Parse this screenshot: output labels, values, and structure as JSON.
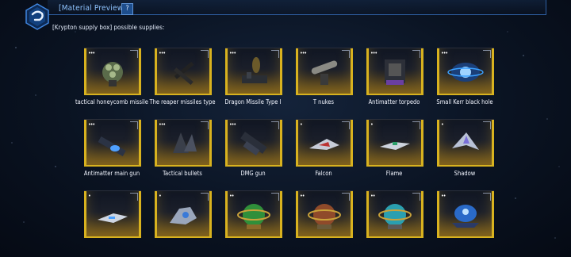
{
  "header": {
    "title": "[Material Preview]",
    "help_label": "?"
  },
  "subtitle": "[Krypton supply box] possible supplies:",
  "colors": {
    "accent_blue": "#3a78c8",
    "frame_gold": "#d8b21f",
    "title_blue": "#8ec3ff"
  },
  "items": [
    {
      "label": "tactical honeycomb missile",
      "icon": "honeycomb-missile-icon",
      "badge": "•••"
    },
    {
      "label": "The reaper missiles type",
      "icon": "reaper-missiles-icon",
      "badge": "•••"
    },
    {
      "label": "Dragon Missile Type I",
      "icon": "dragon-missile-icon",
      "badge": "•••"
    },
    {
      "label": "T nukes",
      "icon": "t-nukes-icon",
      "badge": "•••"
    },
    {
      "label": "Antimatter torpedo",
      "icon": "antimatter-torpedo-icon",
      "badge": "•••"
    },
    {
      "label": "Small Kerr black hole",
      "icon": "kerr-black-hole-icon",
      "badge": "•••"
    },
    {
      "label": "Antimatter main gun",
      "icon": "antimatter-main-gun-icon",
      "badge": "•••"
    },
    {
      "label": "Tactical bullets",
      "icon": "tactical-bullets-icon",
      "badge": "•••"
    },
    {
      "label": "DMG gun",
      "icon": "dmg-gun-icon",
      "badge": "•••"
    },
    {
      "label": "Falcon",
      "icon": "falcon-ship-icon",
      "badge": "•"
    },
    {
      "label": "Flame",
      "icon": "flame-ship-icon",
      "badge": "•"
    },
    {
      "label": "Shadow",
      "icon": "shadow-ship-icon",
      "badge": "•"
    },
    {
      "label": "",
      "icon": "fighter-ship-icon",
      "badge": "•"
    },
    {
      "label": "",
      "icon": "interceptor-ship-icon",
      "badge": "•"
    },
    {
      "label": "",
      "icon": "green-orb-module-icon",
      "badge": "••"
    },
    {
      "label": "",
      "icon": "orange-orb-module-icon",
      "badge": "••"
    },
    {
      "label": "",
      "icon": "cyan-orb-module-icon",
      "badge": "••"
    },
    {
      "label": "",
      "icon": "blue-dome-module-icon",
      "badge": "••"
    }
  ]
}
